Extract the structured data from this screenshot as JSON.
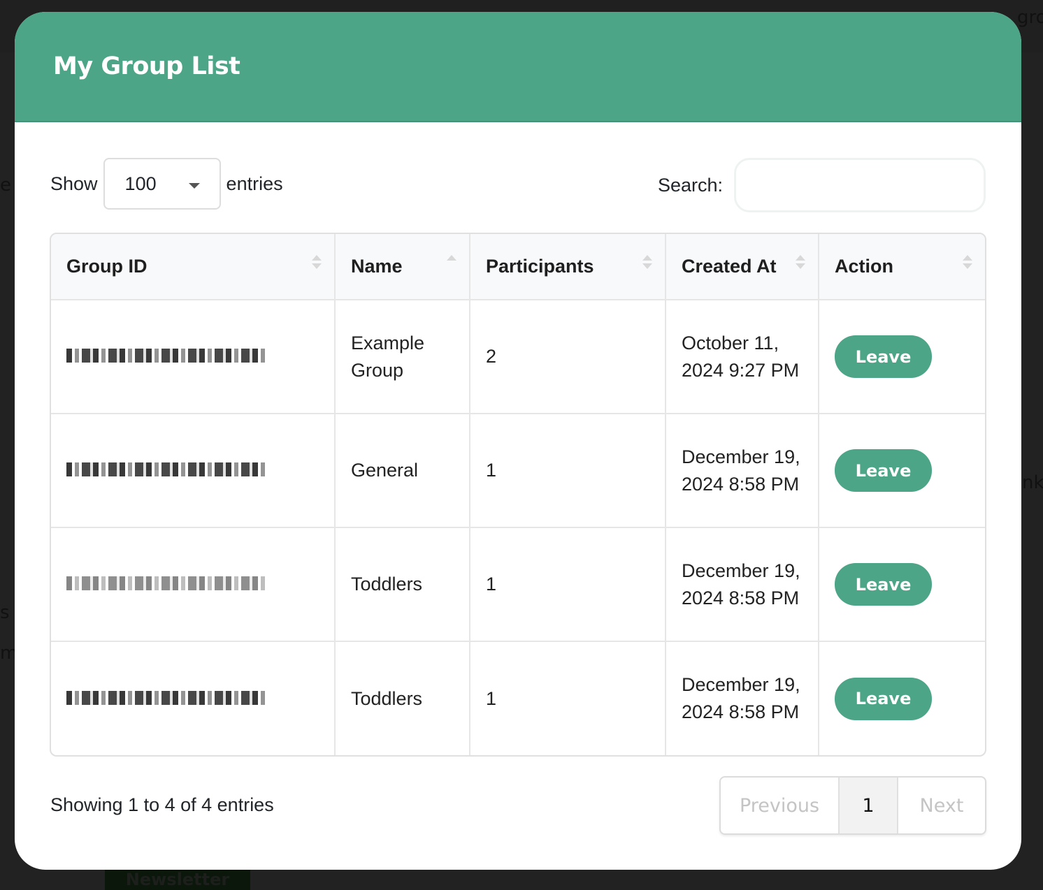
{
  "background": {
    "partial_texts": [
      "gro",
      "e",
      "nk",
      "s",
      "m"
    ],
    "newsletter_label": "Newsletter"
  },
  "modal": {
    "title": "My Group List",
    "accent_color": "#4ca586"
  },
  "length_control": {
    "prefix": "Show",
    "selected": "100",
    "suffix": "entries"
  },
  "search": {
    "label": "Search:",
    "value": "",
    "placeholder": ""
  },
  "table": {
    "columns": [
      {
        "label": "Group ID",
        "sort": "unsorted"
      },
      {
        "label": "Name",
        "sort": "ascending"
      },
      {
        "label": "Participants",
        "sort": "unsorted"
      },
      {
        "label": "Created At",
        "sort": "unsorted"
      },
      {
        "label": "Action",
        "sort": "unsorted"
      }
    ],
    "rows": [
      {
        "group_id": "[redacted]",
        "name": "Example Group",
        "participants": "2",
        "created_at": "October 11, 2024 9:27 PM",
        "action": "Leave"
      },
      {
        "group_id": "[redacted]",
        "name": "General",
        "participants": "1",
        "created_at": "December 19, 2024 8:58 PM",
        "action": "Leave"
      },
      {
        "group_id": "[redacted]",
        "name": "Toddlers",
        "participants": "1",
        "created_at": "December 19, 2024 8:58 PM",
        "action": "Leave"
      },
      {
        "group_id": "[redacted]",
        "name": "Toddlers",
        "participants": "1",
        "created_at": "December 19, 2024 8:58 PM",
        "action": "Leave"
      }
    ]
  },
  "footer": {
    "info": "Showing 1 to 4 of 4 entries",
    "pagination": {
      "previous": "Previous",
      "current": "1",
      "next": "Next"
    }
  }
}
